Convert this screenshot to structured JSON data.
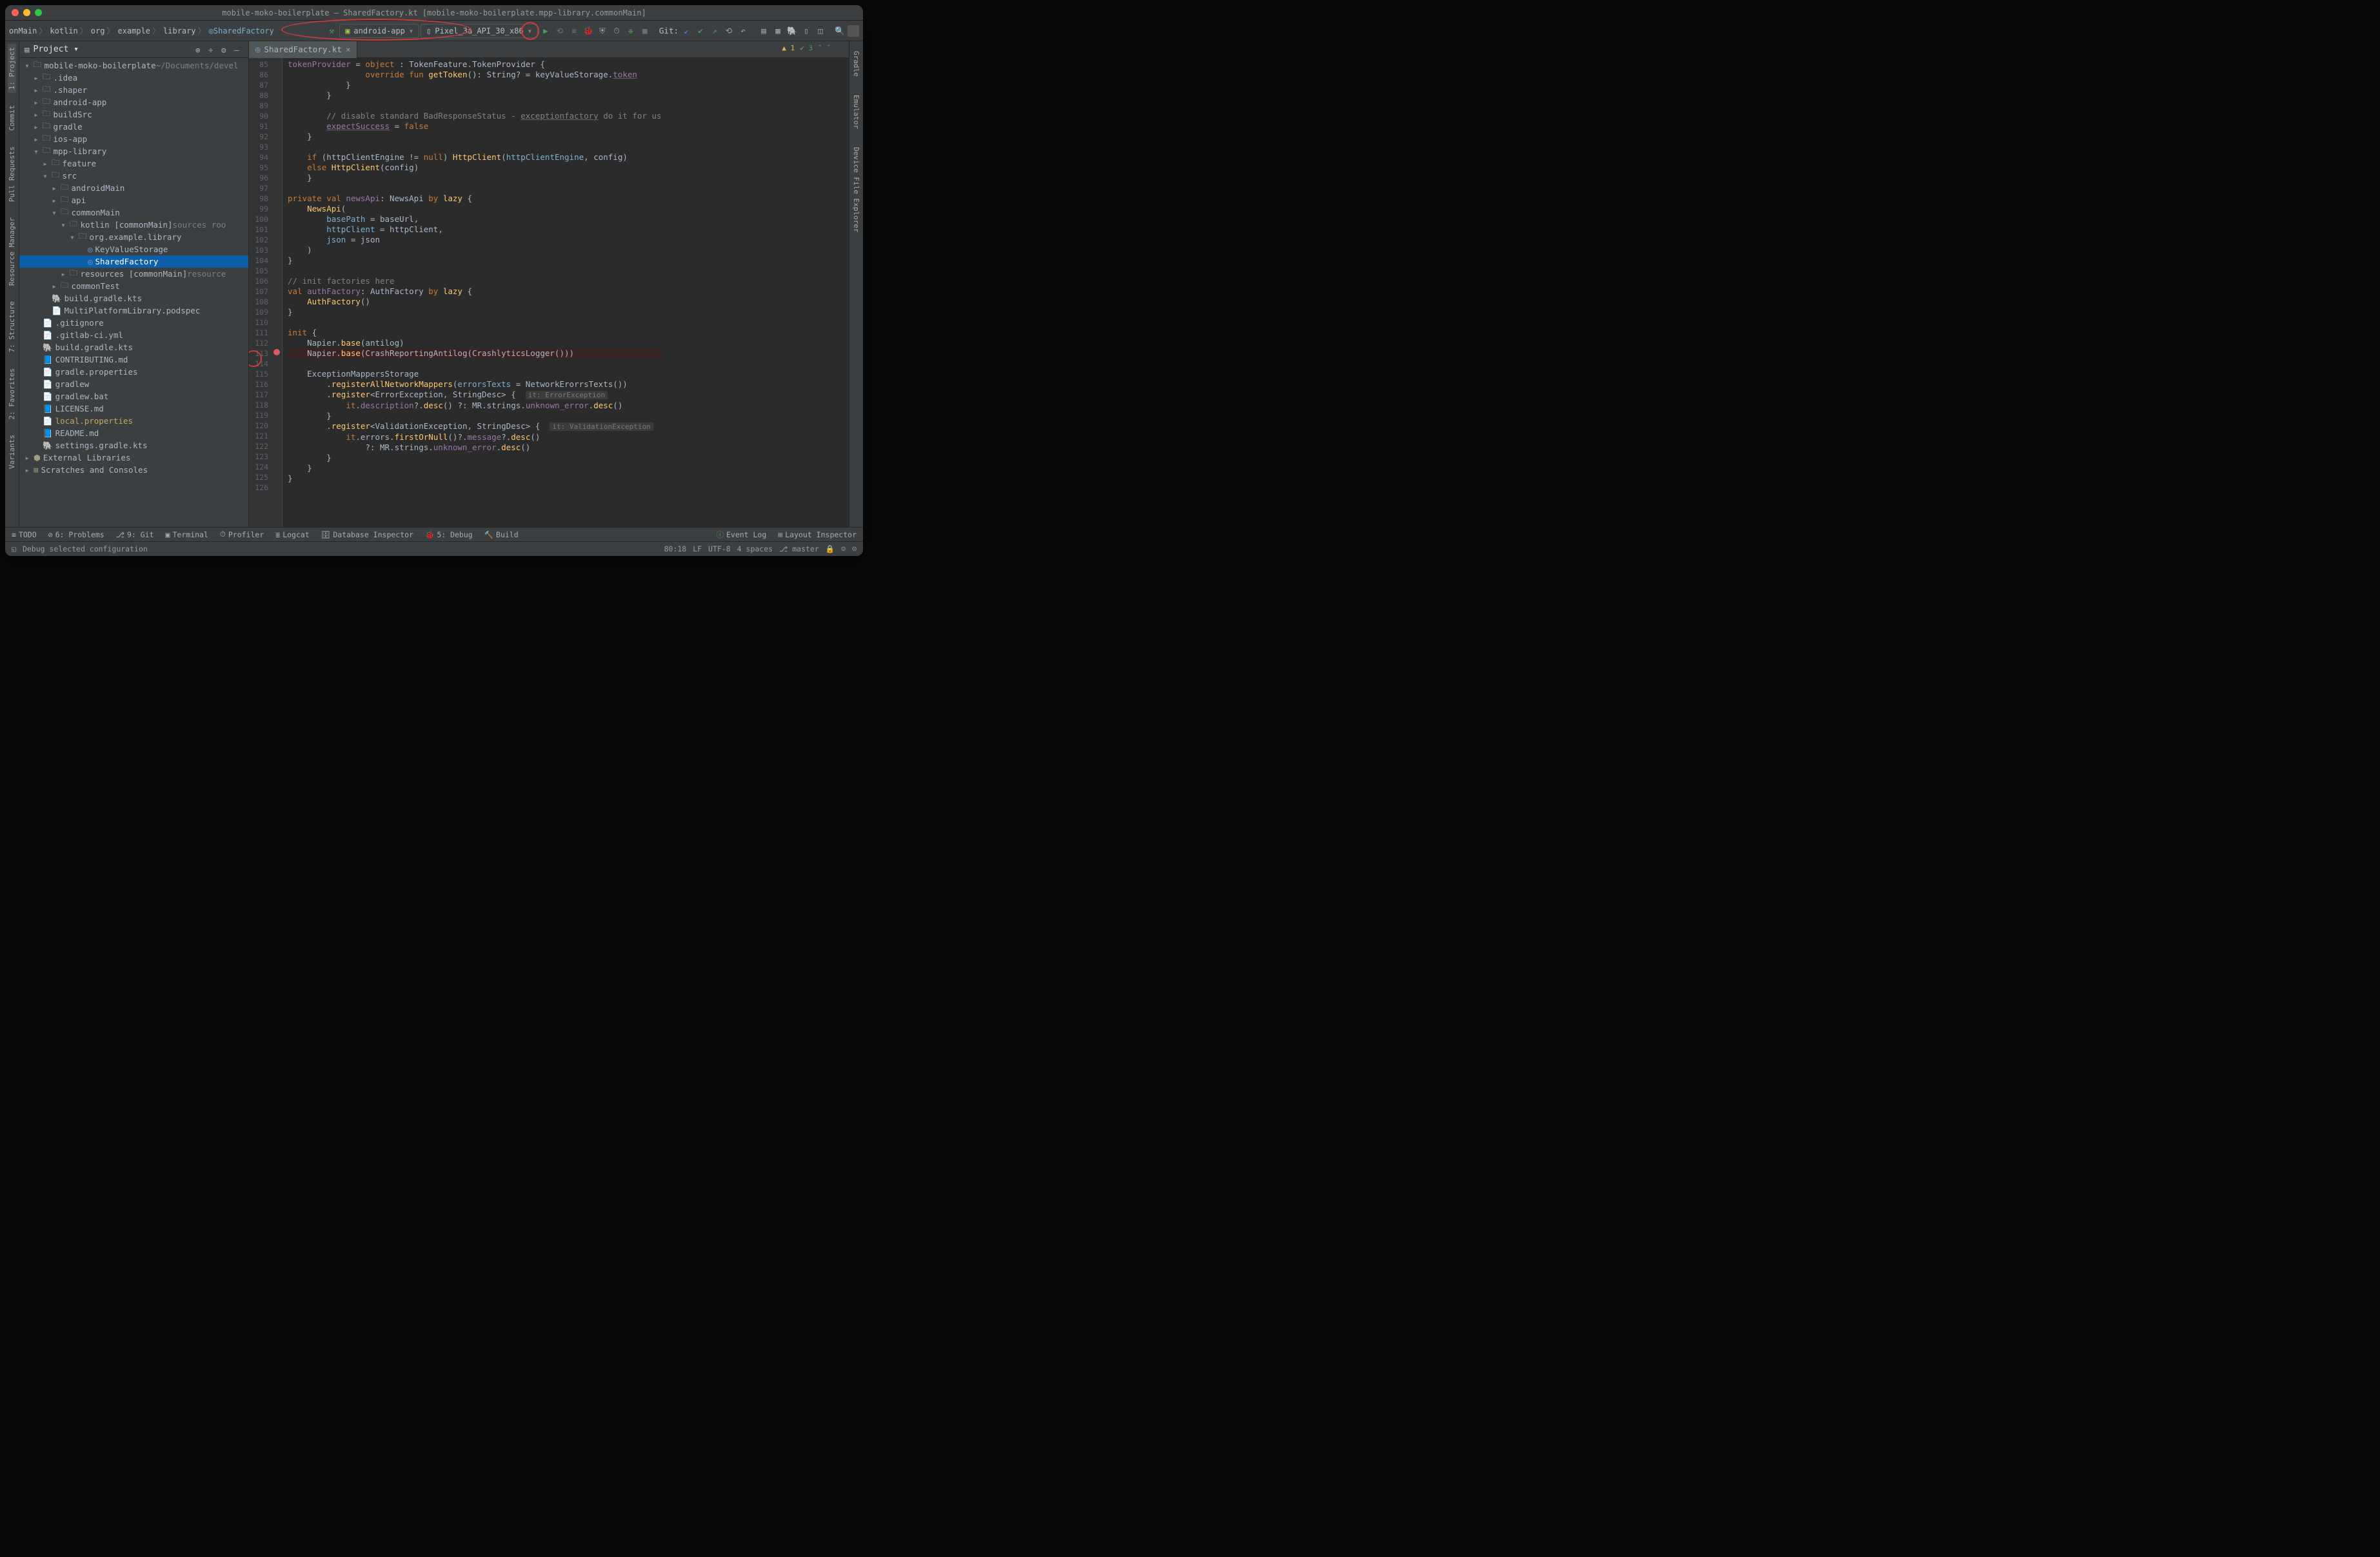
{
  "title": "mobile-moko-boilerplate – SharedFactory.kt [mobile-moko-boilerplate.mpp-library.commonMain]",
  "breadcrumbs": [
    "onMain",
    "kotlin",
    "org",
    "example",
    "library",
    "SharedFactory"
  ],
  "runConfig": {
    "app": "android-app",
    "device": "Pixel_3a_API_30_x86"
  },
  "git_label": "Git:",
  "projectHeader": "Project",
  "tree": {
    "root": "mobile-moko-boilerplate",
    "rootHint": "~/Documents/devel",
    "items": [
      ".idea",
      ".shaper",
      "android-app",
      "buildSrc",
      "gradle",
      "ios-app"
    ],
    "mpp": "mpp-library",
    "feature": "feature",
    "src": "src",
    "androidMain": "androidMain",
    "api": "api",
    "commonMain": "commonMain",
    "kotlinLabel": "kotlin",
    "kotlinSuffix": "[commonMain]",
    "kotlinHint": "sources roo",
    "pkg": "org.example.library",
    "kvs": "KeyValueStorage",
    "sf": "SharedFactory",
    "resources": "resources",
    "resourcesSuffix": "[commonMain]",
    "resourcesHint": "resource",
    "commonTest": "commonTest",
    "buildGradle": "build.gradle.kts",
    "podspec": "MultiPlatformLibrary.podspec",
    "files": [
      ".gitignore",
      ".gitlab-ci.yml",
      "build.gradle.kts",
      "CONTRIBUTING.md",
      "gradle.properties",
      "gradlew",
      "gradlew.bat",
      "LICENSE.md",
      "local.properties",
      "README.md",
      "settings.gradle.kts"
    ],
    "ext": "External Libraries",
    "scratches": "Scratches and Consoles"
  },
  "tab": "SharedFactory.kt",
  "inspections": {
    "warn": "1",
    "ok": "3"
  },
  "lineStart": 85,
  "lineEnd": 126,
  "code": [
    {
      "n": 85,
      "t": "            tokenProvider = object : TokenFeature.TokenProvider {",
      "seg": [
        [
          "prop",
          "tokenProvider"
        ],
        [
          "",
          " = "
        ],
        [
          "kw",
          "object"
        ],
        [
          "",
          " : TokenFeature.TokenProvider {"
        ]
      ]
    },
    {
      "n": 86,
      "t": "                override fun getToken(): String? = keyValueStorage.token",
      "seg": [
        [
          "",
          "                "
        ],
        [
          "kw",
          "override fun "
        ],
        [
          "fn",
          "getToken"
        ],
        [
          "",
          "(): String? = keyValueStorage."
        ],
        [
          "prop hl-under",
          "token"
        ]
      ]
    },
    {
      "n": 87,
      "t": "            }"
    },
    {
      "n": 88,
      "t": "        }"
    },
    {
      "n": 89,
      "t": ""
    },
    {
      "n": 90,
      "t": "        // disable standard BadResponseStatus - exceptionfactory do it for us",
      "seg": [
        [
          "",
          "        "
        ],
        [
          "cmt",
          "// disable standard BadResponseStatus - "
        ],
        [
          "cmt hl-under",
          "exceptionfactory"
        ],
        [
          "cmt",
          " do it for us"
        ]
      ]
    },
    {
      "n": 91,
      "t": "        expectSuccess = false",
      "seg": [
        [
          "",
          "        "
        ],
        [
          "prop hl-under",
          "expectSuccess"
        ],
        [
          "",
          " = "
        ],
        [
          "kw",
          "false"
        ]
      ]
    },
    {
      "n": 92,
      "t": "    }"
    },
    {
      "n": 93,
      "t": ""
    },
    {
      "n": 94,
      "t": "    if (httpClientEngine != null) HttpClient(httpClientEngine, config)",
      "seg": [
        [
          "",
          "    "
        ],
        [
          "kw",
          "if"
        ],
        [
          "",
          " (httpClientEngine != "
        ],
        [
          "kw",
          "null"
        ],
        [
          "",
          ") "
        ],
        [
          "fn",
          "HttpClient"
        ],
        [
          "",
          "("
        ],
        [
          "param",
          "httpClientEngine"
        ],
        [
          "",
          ", config)"
        ]
      ]
    },
    {
      "n": 95,
      "t": "    else HttpClient(config)",
      "seg": [
        [
          "",
          "    "
        ],
        [
          "kw",
          "else"
        ],
        [
          "",
          " "
        ],
        [
          "fn",
          "HttpClient"
        ],
        [
          "",
          "(config)"
        ]
      ]
    },
    {
      "n": 96,
      "t": "    }"
    },
    {
      "n": 97,
      "t": ""
    },
    {
      "n": 98,
      "t": "private val newsApi: NewsApi by lazy {",
      "seg": [
        [
          "kw",
          "private val "
        ],
        [
          "prop",
          "newsApi"
        ],
        [
          "",
          ": NewsApi "
        ],
        [
          "kw",
          "by"
        ],
        [
          "",
          " "
        ],
        [
          "fn",
          "lazy"
        ],
        [
          "",
          " {"
        ]
      ]
    },
    {
      "n": 99,
      "t": "    NewsApi(",
      "seg": [
        [
          "",
          "    "
        ],
        [
          "fn",
          "NewsApi"
        ],
        [
          "",
          "("
        ]
      ]
    },
    {
      "n": 100,
      "t": "        basePath = baseUrl,",
      "seg": [
        [
          "",
          "        "
        ],
        [
          "param",
          "basePath"
        ],
        [
          "",
          " = baseUrl,"
        ]
      ]
    },
    {
      "n": 101,
      "t": "        httpClient = httpClient,",
      "seg": [
        [
          "",
          "        "
        ],
        [
          "param",
          "httpClient"
        ],
        [
          "",
          " = httpClient,"
        ]
      ]
    },
    {
      "n": 102,
      "t": "        json = json",
      "seg": [
        [
          "",
          "        "
        ],
        [
          "param",
          "json"
        ],
        [
          "",
          " = json"
        ]
      ]
    },
    {
      "n": 103,
      "t": "    )"
    },
    {
      "n": 104,
      "t": "}"
    },
    {
      "n": 105,
      "t": ""
    },
    {
      "n": 106,
      "t": "// init factories here",
      "seg": [
        [
          "cmt",
          "// init factories here"
        ]
      ]
    },
    {
      "n": 107,
      "t": "val authFactory: AuthFactory by lazy {",
      "seg": [
        [
          "kw",
          "val "
        ],
        [
          "prop",
          "authFactory"
        ],
        [
          "",
          ": AuthFactory "
        ],
        [
          "kw",
          "by"
        ],
        [
          "",
          " "
        ],
        [
          "fn",
          "lazy"
        ],
        [
          "",
          " {"
        ]
      ]
    },
    {
      "n": 108,
      "t": "    AuthFactory()",
      "seg": [
        [
          "",
          "    "
        ],
        [
          "fn",
          "AuthFactory"
        ],
        [
          "",
          "()"
        ]
      ]
    },
    {
      "n": 109,
      "t": "}"
    },
    {
      "n": 110,
      "t": ""
    },
    {
      "n": 111,
      "t": "init {",
      "seg": [
        [
          "kw",
          "init"
        ],
        [
          "",
          " {"
        ]
      ]
    },
    {
      "n": 112,
      "t": "    Napier.base(antilog)",
      "seg": [
        [
          "",
          "    Napier."
        ],
        [
          "fn",
          "base"
        ],
        [
          "",
          "(antilog)"
        ]
      ]
    },
    {
      "n": 113,
      "t": "    Napier.base(CrashReportingAntilog(CrashlyticsLogger()))",
      "bp": true,
      "seg": [
        [
          "",
          "    Napier."
        ],
        [
          "fn",
          "base"
        ],
        [
          "",
          "(CrashReportingAntilog(CrashlyticsLogger()))"
        ]
      ]
    },
    {
      "n": 114,
      "t": ""
    },
    {
      "n": 115,
      "t": "    ExceptionMappersStorage"
    },
    {
      "n": 116,
      "t": "        .registerAllNetworkMappers(errorsTexts = NetworkErorrsTexts())",
      "seg": [
        [
          "",
          "        ."
        ],
        [
          "fn",
          "registerAllNetworkMappers"
        ],
        [
          "",
          "("
        ],
        [
          "param",
          "errorsTexts"
        ],
        [
          "",
          " = NetworkErorrsTexts())"
        ]
      ]
    },
    {
      "n": 117,
      "t": "        .register<ErrorException, StringDesc> {",
      "seg": [
        [
          "",
          "        ."
        ],
        [
          "fn",
          "register"
        ],
        [
          "",
          "<ErrorException, StringDesc> {  "
        ],
        [
          "hint",
          "it: ErrorException"
        ]
      ]
    },
    {
      "n": 118,
      "t": "            it.description?.desc() ?: MR.strings.unknown_error.desc()",
      "seg": [
        [
          "",
          "            "
        ],
        [
          "kw",
          "it"
        ],
        [
          "",
          "."
        ],
        [
          "prop",
          "description"
        ],
        [
          "",
          "?."
        ],
        [
          "fn",
          "desc"
        ],
        [
          "",
          "() ?: MR.strings."
        ],
        [
          "prop",
          "unknown_error"
        ],
        [
          "",
          "."
        ],
        [
          "fn",
          "desc"
        ],
        [
          "",
          "()"
        ]
      ]
    },
    {
      "n": 119,
      "t": "        }"
    },
    {
      "n": 120,
      "t": "        .register<ValidationException, StringDesc> {",
      "seg": [
        [
          "",
          "        ."
        ],
        [
          "fn",
          "register"
        ],
        [
          "",
          "<ValidationException, StringDesc> {  "
        ],
        [
          "hint",
          "it: ValidationException"
        ]
      ]
    },
    {
      "n": 121,
      "t": "            it.errors.firstOrNull()?.message?.desc()",
      "seg": [
        [
          "",
          "            "
        ],
        [
          "kw",
          "it"
        ],
        [
          "",
          ".errors."
        ],
        [
          "fn",
          "firstOrNull"
        ],
        [
          "",
          "()?."
        ],
        [
          "prop",
          "message"
        ],
        [
          "",
          "?."
        ],
        [
          "fn",
          "desc"
        ],
        [
          "",
          "()"
        ]
      ]
    },
    {
      "n": 122,
      "t": "                ?: MR.strings.unknown_error.desc()",
      "seg": [
        [
          "",
          "                ?: MR.strings."
        ],
        [
          "prop",
          "unknown_error"
        ],
        [
          "",
          "."
        ],
        [
          "fn",
          "desc"
        ],
        [
          "",
          "()"
        ]
      ]
    },
    {
      "n": 123,
      "t": "        }"
    },
    {
      "n": 124,
      "t": "    }"
    },
    {
      "n": 125,
      "t": "}"
    },
    {
      "n": 126,
      "t": ""
    }
  ],
  "bottom": [
    "TODO",
    "6: Problems",
    "9: Git",
    "Terminal",
    "Profiler",
    "Logcat",
    "Database Inspector",
    "5: Debug",
    "Build"
  ],
  "bottomRight": [
    "Event Log",
    "Layout Inspector"
  ],
  "statusMsg": "Debug selected configuration",
  "statusRight": {
    "pos": "80:18",
    "le": "LF",
    "enc": "UTF-8",
    "indent": "4 spaces",
    "branch": "master"
  },
  "leftSide": [
    "1: Project",
    "Commit",
    "Pull Requests",
    "Resource Manager",
    "7: Structure",
    "2: Favorites",
    "Variants"
  ],
  "rightSide": [
    "Gradle",
    "Emulator",
    "Device File Explorer"
  ]
}
